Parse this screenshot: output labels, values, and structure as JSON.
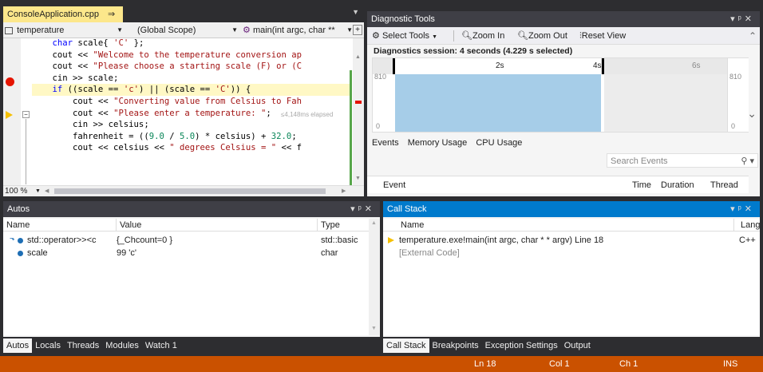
{
  "editor": {
    "tab_title": "ConsoleApplication.cpp",
    "pin_glyph": "⇒",
    "close_glyph": "✕",
    "nav_member": "temperature",
    "nav_scope": "(Global Scope)",
    "nav_function": "main(int argc, char **",
    "zoom": "100 %",
    "perf_tip": "≤4,148ms elapsed",
    "lines": [
      "    char scale{ 'C' };",
      "",
      "    cout << \"Welcome to the temperature conversion ap",
      "    cout << \"Please choose a starting scale (F) or (C",
      "    cin >> scale;",
      "    if ((scale == 'c') || (scale == 'C')) {",
      "        cout << \"Converting value from Celsius to Fah",
      "        cout << \"Please enter a temperature: \";",
      "        cin >> celsius;",
      "        fahrenheit = ((9.0 / 5.0) * celsius) + 32.0;",
      "        cout << celsius << \" degrees Celsius = \" << f"
    ]
  },
  "diagnostics": {
    "title": "Diagnostic Tools",
    "select_tools": "Select Tools",
    "zoom_in": "Zoom In",
    "zoom_out": "Zoom Out",
    "reset_view": "Reset View",
    "session": "Diagnostics session: 4 seconds (4.229 s selected)",
    "ticks": [
      "2s",
      "4s",
      "6s"
    ],
    "y_top": "810",
    "y_bottom": "0",
    "tabs": [
      "Events",
      "Memory Usage",
      "CPU Usage"
    ],
    "search_placeholder": "Search Events",
    "columns": [
      "Event",
      "Time",
      "Duration",
      "Thread"
    ]
  },
  "autos": {
    "title": "Autos",
    "columns": [
      "Name",
      "Value",
      "Type"
    ],
    "rows": [
      {
        "name": "std::operator>><c",
        "value": "{_Chcount=0 }",
        "type": "std::basic"
      },
      {
        "name": "scale",
        "value": "99 'c'",
        "type": "char"
      }
    ],
    "tabs": [
      "Autos",
      "Locals",
      "Threads",
      "Modules",
      "Watch 1"
    ]
  },
  "callstack": {
    "title": "Call Stack",
    "columns": [
      "Name",
      "Lang"
    ],
    "rows": [
      {
        "name": "temperature.exe!main(int argc, char * * argv) Line 18",
        "lang": "C++"
      },
      {
        "name": "[External Code]",
        "lang": ""
      }
    ],
    "tabs": [
      "Call Stack",
      "Breakpoints",
      "Exception Settings",
      "Output"
    ]
  },
  "statusbar": {
    "line": "Ln 18",
    "col": "Col 1",
    "ch": "Ch 1",
    "mode": "INS"
  },
  "colors": {
    "accent": "#007acc",
    "statusbar": "#ca5100",
    "breakpoint": "#e51400",
    "cpu_fill": "#a6cde8"
  }
}
